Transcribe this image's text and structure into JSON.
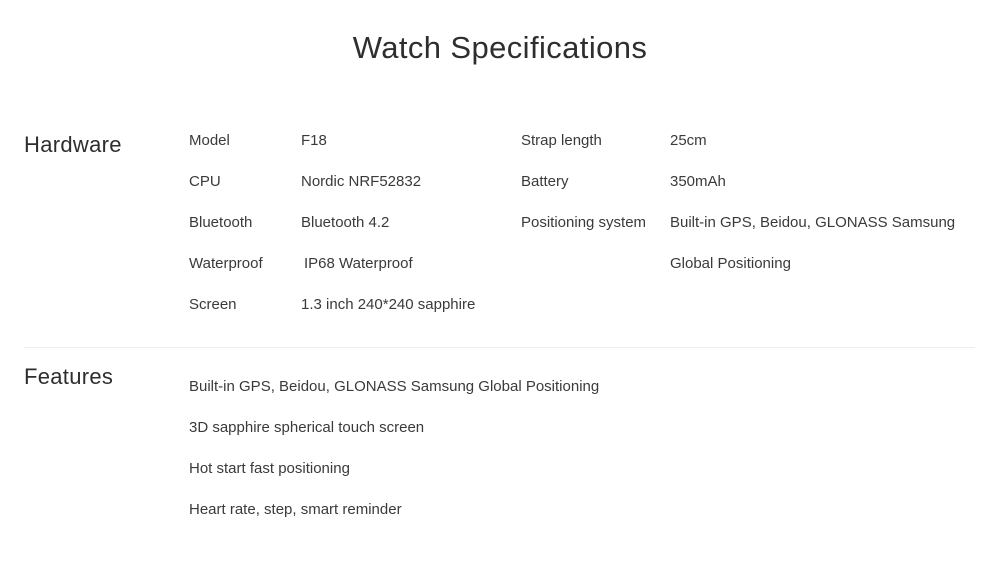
{
  "page": {
    "title": "Watch Specifications",
    "background_color": "#ffffff",
    "text_color": "#3a3a3a",
    "divider_color": "#ededed"
  },
  "sections": {
    "hardware": {
      "label": "Hardware",
      "left_column": [
        {
          "key": "Model",
          "value": "F18"
        },
        {
          "key": "CPU",
          "value": "Nordic NRF52832"
        },
        {
          "key": "Bluetooth",
          "value": "Bluetooth 4.2"
        },
        {
          "key": "Waterproof",
          "value": "IP68 Waterproof"
        },
        {
          "key": "Screen",
          "value": "1.3 inch 240*240 sapphire"
        }
      ],
      "right_column": [
        {
          "key": "Strap length",
          "value": "25cm"
        },
        {
          "key": "Battery",
          "value": "350mAh"
        },
        {
          "key": "Positioning system",
          "value": "Built-in GPS, Beidou, GLONASS Samsung"
        },
        {
          "key": "",
          "value": "Global Positioning"
        }
      ]
    },
    "features": {
      "label": "Features",
      "items": [
        "Built-in GPS, Beidou, GLONASS Samsung Global Positioning",
        "3D sapphire spherical touch screen",
        "Hot start fast positioning",
        "Heart rate, step, smart reminder"
      ]
    }
  }
}
